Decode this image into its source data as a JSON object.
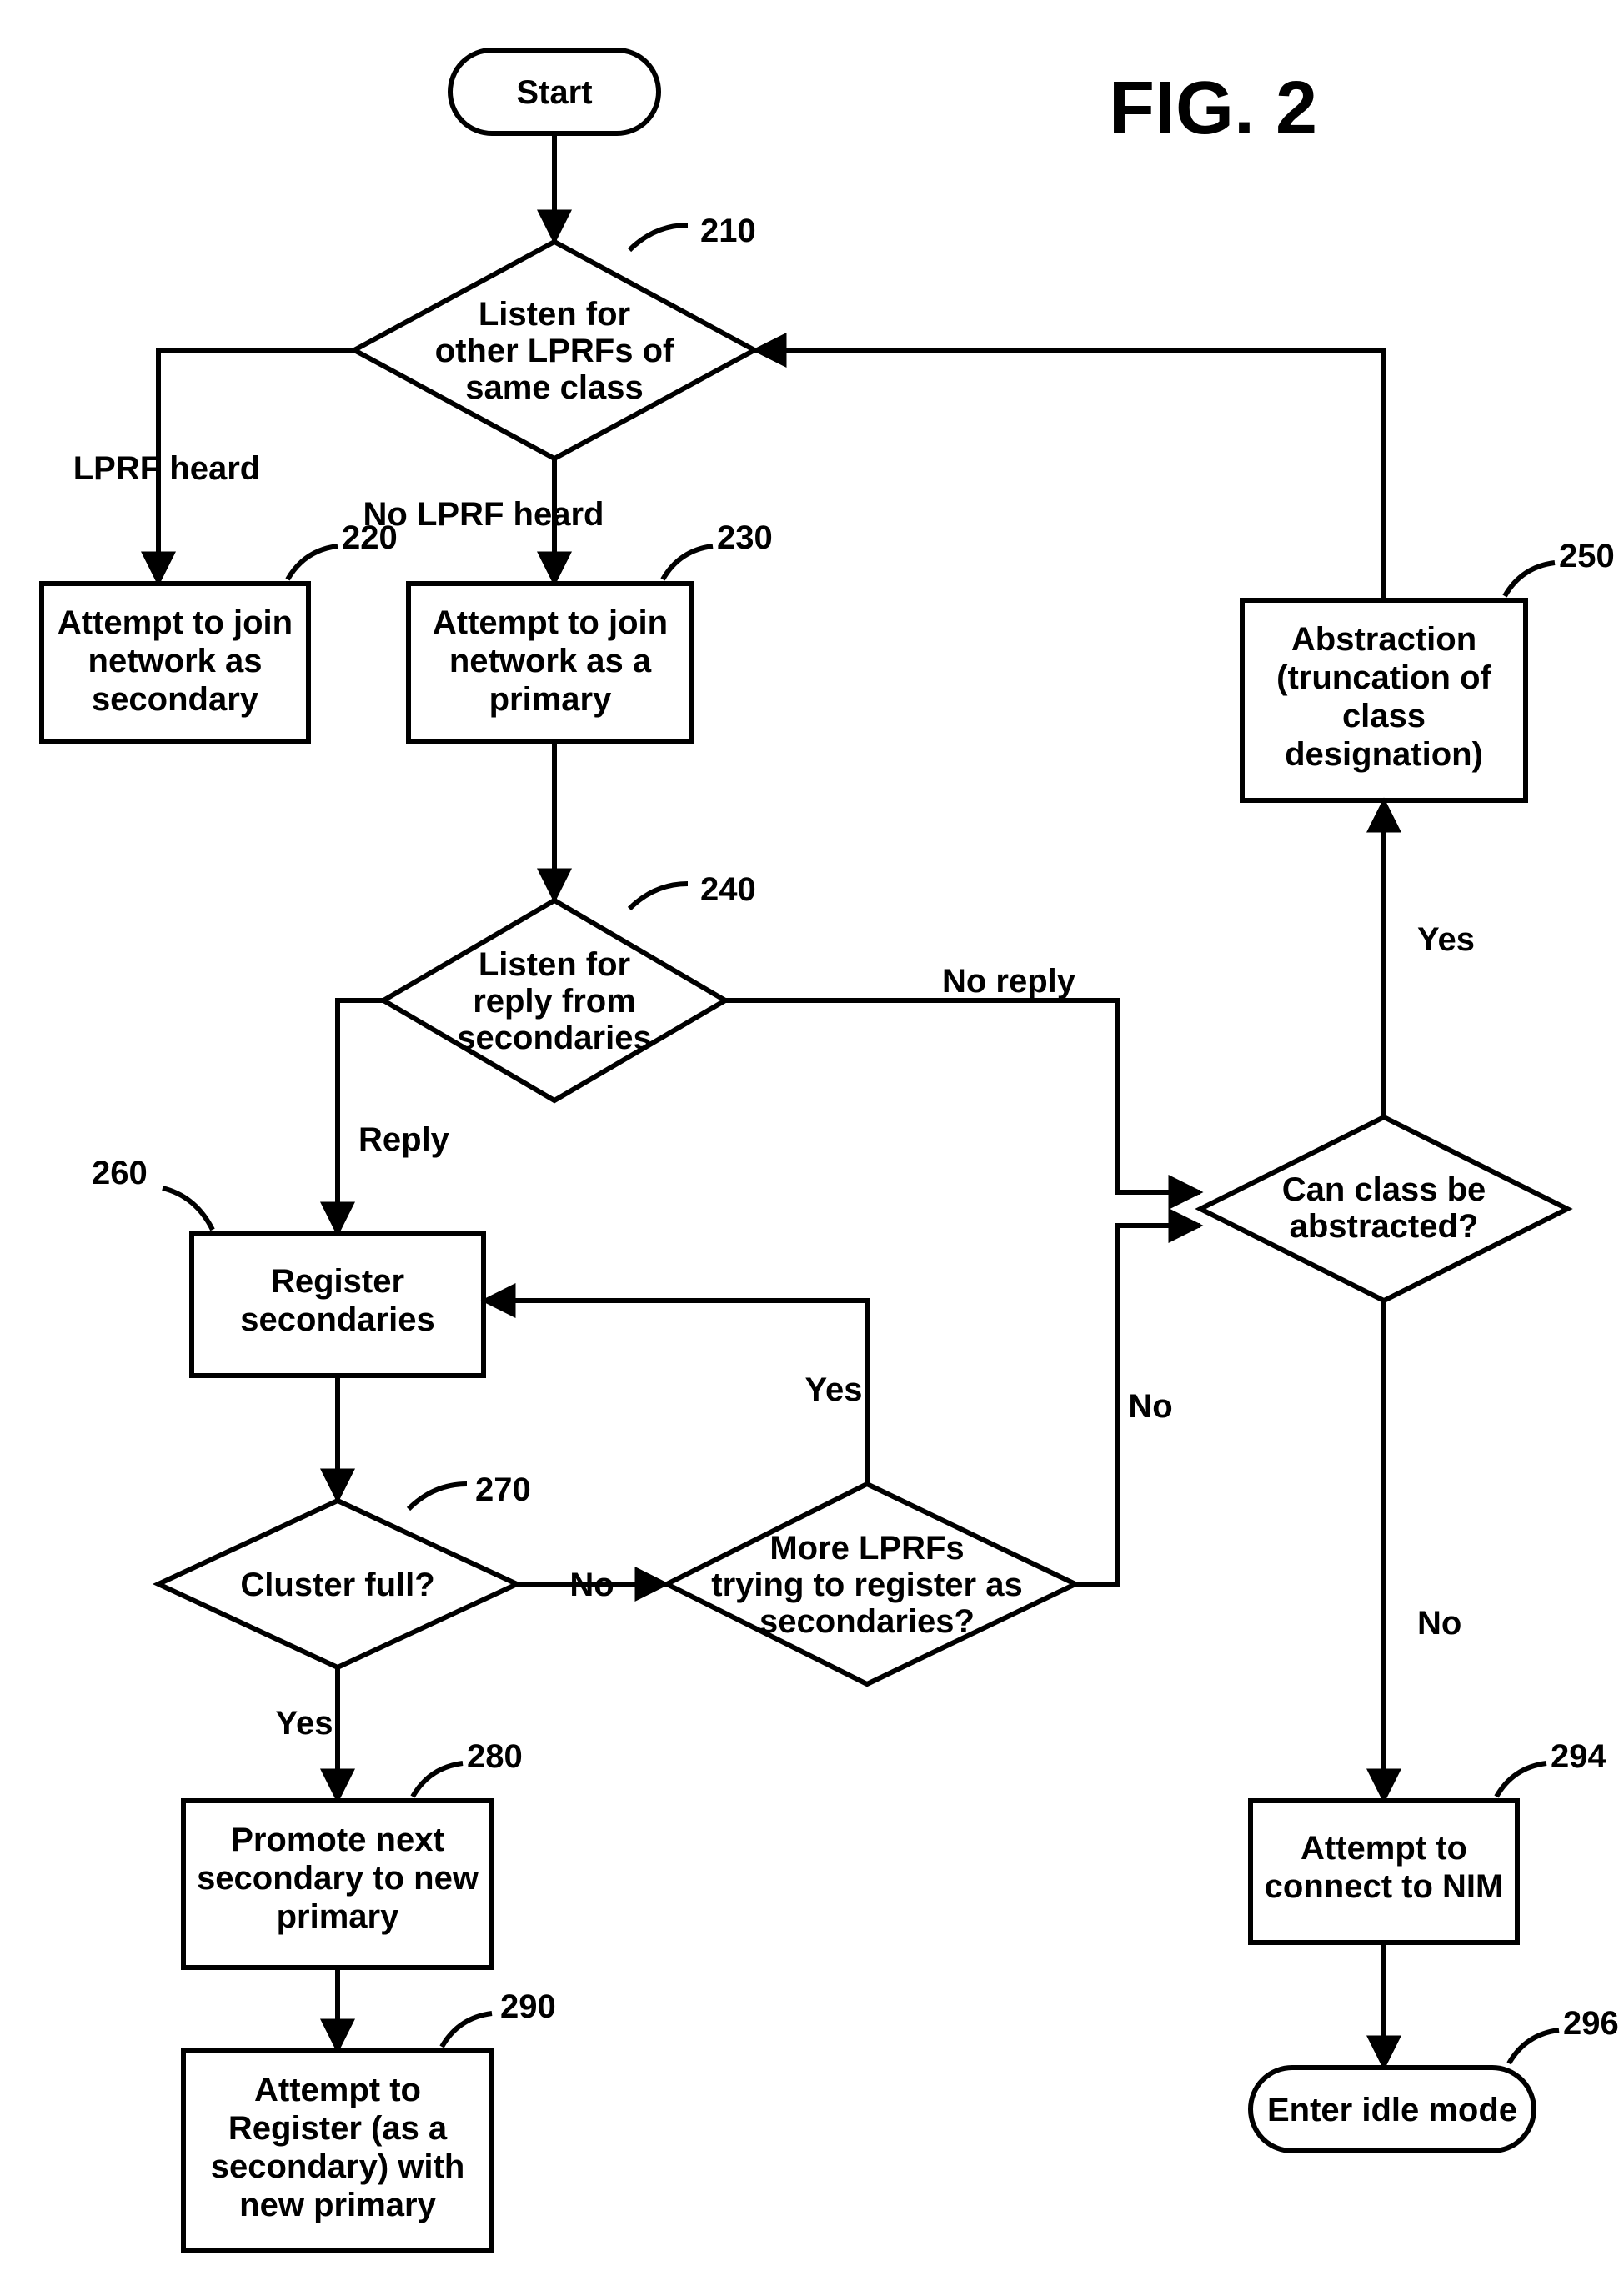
{
  "figure_title": "FIG. 2",
  "nodes": {
    "start": "Start",
    "n210": [
      "Listen for",
      "other LPRFs of",
      "same class"
    ],
    "n220": [
      "Attempt to join",
      "network as",
      "secondary"
    ],
    "n230": [
      "Attempt to join",
      "network as a",
      "primary"
    ],
    "n240": [
      "Listen for",
      "reply from",
      "secondaries"
    ],
    "n250": [
      "Abstraction",
      "(truncation of",
      "class",
      "designation)"
    ],
    "n260": [
      "Register",
      "secondaries"
    ],
    "n270": "Cluster full?",
    "n270a": [
      "More LPRFs",
      "trying to register as",
      "secondaries?"
    ],
    "n270b": [
      "Can class be",
      "abstracted?"
    ],
    "n280": [
      "Promote next",
      "secondary to new",
      "primary"
    ],
    "n290": [
      "Attempt to",
      "Register (as a",
      "secondary) with",
      "new primary"
    ],
    "n294": [
      "Attempt to",
      "connect to NIM"
    ],
    "n296": "Enter idle mode"
  },
  "refs": {
    "r210": "210",
    "r220": "220",
    "r230": "230",
    "r240": "240",
    "r250": "250",
    "r260": "260",
    "r270": "270",
    "r280": "280",
    "r290": "290",
    "r294": "294",
    "r296": "296"
  },
  "edges": {
    "e_210_left": "LPRF heard",
    "e_210_down": "No LPRF heard",
    "e_240_left": "Reply",
    "e_240_right": "No reply",
    "e_270_yes": "Yes",
    "e_270_no": "No",
    "e_270a_yes": "Yes",
    "e_270a_no": "No",
    "e_270b_yes": "Yes",
    "e_270b_no": "No"
  }
}
